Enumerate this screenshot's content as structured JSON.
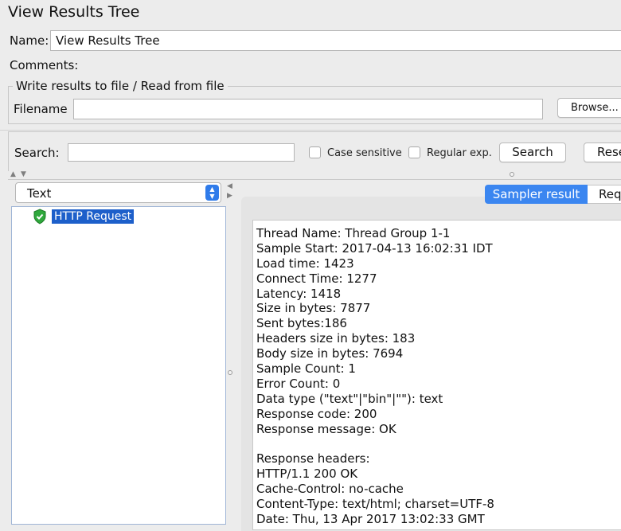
{
  "window": {
    "title": "View Results Tree"
  },
  "name_row": {
    "label": "Name:",
    "value": "View Results Tree"
  },
  "comments_row": {
    "label": "Comments:"
  },
  "file_group": {
    "legend": "Write results to file / Read from file",
    "filename_label": "Filename",
    "filename_value": "",
    "browse_label": "Browse..."
  },
  "search_bar": {
    "label": "Search:",
    "value": "",
    "case_sensitive_label": "Case sensitive",
    "regular_exp_label": "Regular exp.",
    "search_button": "Search",
    "reset_button": "Rese"
  },
  "renderer_select": {
    "selected": "Text"
  },
  "tree": {
    "nodes": [
      {
        "label": "HTTP Request",
        "status": "success",
        "icon": "shield-check-icon",
        "selected": true
      }
    ]
  },
  "result_tabs": {
    "active": "Sampler result",
    "next": "Req"
  },
  "colors": {
    "accent": "#3b86f0",
    "selection": "#1d5fca",
    "success": "#2fa83c"
  },
  "sampler_result": {
    "lines": [
      "Thread Name: Thread Group 1-1",
      "Sample Start: 2017-04-13 16:02:31 IDT",
      "Load time: 1423",
      "Connect Time: 1277",
      "Latency: 1418",
      "Size in bytes: 7877",
      "Sent bytes:186",
      "Headers size in bytes: 183",
      "Body size in bytes: 7694",
      "Sample Count: 1",
      "Error Count: 0",
      "Data type (\"text\"|\"bin\"|\"\"): text",
      "Response code: 200",
      "Response message: OK",
      "",
      "Response headers:",
      "HTTP/1.1 200 OK",
      "Cache-Control: no-cache",
      "Content-Type: text/html; charset=UTF-8",
      "Date: Thu, 13 Apr 2017 13:02:33 GMT"
    ]
  }
}
